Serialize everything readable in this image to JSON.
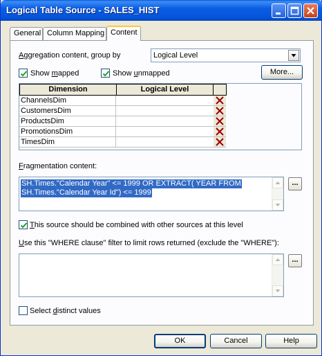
{
  "window": {
    "title": "Logical Table Source - SALES_HIST"
  },
  "tabs": [
    "General",
    "Column Mapping",
    "Content"
  ],
  "aggregation": {
    "label_pre": "",
    "label_u": "A",
    "label_post": "ggregation content, group by",
    "selected": "Logical Level"
  },
  "show_mapped": {
    "pre": "Show ",
    "u": "m",
    "post": "apped",
    "checked": true
  },
  "show_unmapped": {
    "pre": "Show ",
    "u": "u",
    "post": "nmapped",
    "checked": true
  },
  "more_button": "More...",
  "table": {
    "headers": [
      "Dimension",
      "Logical Level"
    ],
    "rows": [
      {
        "dimension": "ChannelsDim",
        "level": ""
      },
      {
        "dimension": "CustomersDim",
        "level": ""
      },
      {
        "dimension": "ProductsDim",
        "level": ""
      },
      {
        "dimension": "PromotionsDim",
        "level": ""
      },
      {
        "dimension": "TimesDim",
        "level": ""
      }
    ]
  },
  "fragmentation": {
    "label_u": "F",
    "label_post": "ragmentation content:",
    "lines": [
      "SH.Times.\"Calendar Year\" <= 1999 OR  EXTRACT( YEAR  FROM",
      "SH.Times.\"Calendar Year Id\") <= 1999"
    ],
    "ellipsis": "..."
  },
  "combine": {
    "u": "T",
    "post": "his source should be combined with other sources at this level",
    "checked": true
  },
  "where": {
    "u": "U",
    "post": "se this \"WHERE clause\" filter to limit rows returned (exclude the \"WHERE\"):",
    "value": "",
    "ellipsis": "..."
  },
  "distinct": {
    "pre": "Select ",
    "u": "d",
    "post": "istinct values",
    "checked": false
  },
  "buttons": {
    "ok": "OK",
    "cancel": "Cancel",
    "help": "Help"
  },
  "colors": {
    "title_bar": "#0a5ee4",
    "selection": "#316ac5",
    "delete_x": "#c00000"
  }
}
